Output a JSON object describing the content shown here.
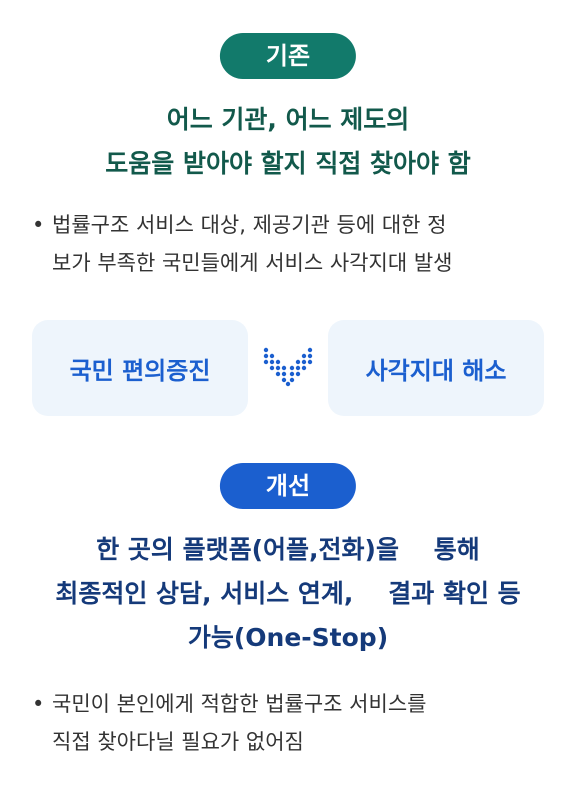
{
  "before": {
    "badge": "기존",
    "headline": [
      "어느 기관, 어느 제도의",
      "도움을 받아야 할지 직접 찾아야 함"
    ],
    "bullet": [
      "법률구조 서비스 대상, 제공기관 등에 대한 정",
      "보가 부족한 국민들에게 서비스 사각지대 발생"
    ]
  },
  "transition": {
    "from": "국민 편의증진",
    "to": "사각지대 해소",
    "icon": "chevron-down-dots-icon"
  },
  "after": {
    "badge": "개선",
    "headline": [
      "한 곳의 플랫폼(어플,전화)을    통해",
      "최종적인 상담, 서비스 연계,    결과 확인 등",
      "가능(One-Stop)"
    ],
    "bullet": [
      "국민이 본인에게 적합한 법률구조 서비스를",
      "직접 찾아다닐 필요가 없어짐"
    ]
  },
  "colors": {
    "before_accent": "#127a6b",
    "before_text": "#12594b",
    "after_accent": "#1b5fcf",
    "after_text": "#153a7a",
    "box_bg": "#eef5fc"
  }
}
